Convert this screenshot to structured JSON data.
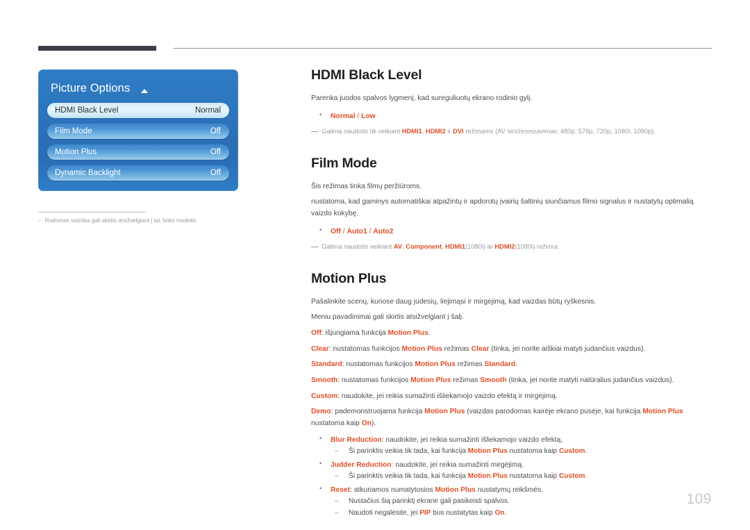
{
  "page": {
    "number": "109"
  },
  "osd": {
    "title": "Picture Options",
    "rows": [
      {
        "label": "HDMI Black Level",
        "value": "Normal",
        "selected": true
      },
      {
        "label": "Film Mode",
        "value": "Off",
        "selected": false
      },
      {
        "label": "Motion Plus",
        "value": "Off",
        "selected": false
      },
      {
        "label": "Dynamic Backlight",
        "value": "Off",
        "selected": false
      }
    ],
    "footnote": "Rodomas vaizdas gali skirtis atsižvelgiant į tai, koks modelis.",
    "footnote_dash": "–"
  },
  "colors": {
    "accent": "#e04f26",
    "osd_blue": "#2c72ba",
    "rule_dark": "#423d4b"
  },
  "sections": {
    "hdmi_black_level": {
      "heading": "HDMI Black Level",
      "intro": "Parenka juodos spalvos lygmenį, kad sureguliuotų ekrano rodinio gylį.",
      "options": "Normal / Low",
      "option_a": "Normal",
      "option_sep": " / ",
      "option_b": "Low",
      "note_pre": "Galima naudotis tik veikiant ",
      "note_t1": "HDMI1",
      "note_mid1": ", ",
      "note_t2": "HDMI2",
      "note_mid2": " ir ",
      "note_t3": "DVI",
      "note_post": " režimams (AV sinchronizavimas: 480p, 576p, 720p, 1080i, 1080p)."
    },
    "film_mode": {
      "heading": "Film Mode",
      "line1": "Šis režimas tinka filmų peržiūroms.",
      "line2": "nustatoma, kad gaminys automatiškai atpažintų ir apdorotų įvairių šaltinių siunčiamus filmo signalus ir nustatytų optimalią vaizdo kokybę.",
      "opt_a": "Off",
      "opt_sep1": " / ",
      "opt_b": "Auto1",
      "opt_sep2": " / ",
      "opt_c": "Auto2",
      "note_pre": "Galima naudotis veikiant ",
      "note_t1": "AV",
      "note_mid1": ", ",
      "note_t2": "Component",
      "note_mid2": ", ",
      "note_t3": "HDMI1",
      "note_mid3": "(1080i) ar ",
      "note_t4": "HDMI2",
      "note_post": "(1080i) režimui."
    },
    "motion_plus": {
      "heading": "Motion Plus",
      "intro1": "Pašalinkite scenų, kuriose daug judesių, liejimąsi ir mirgėjimą, kad vaizdas būtų ryškesnis.",
      "intro2": "Meniu pavadinimai gali skirtis atsižvelgiant į šalį.",
      "off_term": "Off",
      "off_text1": ": išjungiama funkcija ",
      "off_term2": "Motion Plus",
      "off_text2": ".",
      "clear_term": "Clear",
      "clear_text1": ": nustatomas funkcijos ",
      "clear_term2": "Motion Plus",
      "clear_text2": " režimas ",
      "clear_term3": "Clear",
      "clear_text3": " (tinka, jei norite aiškiai matyti judančius vaizdus).",
      "standard_term": "Standard",
      "standard_text1": ": nustatomas funkcijos ",
      "standard_term2": "Motion Plus",
      "standard_text2": " režimas ",
      "standard_term3": "Standard",
      "standard_text3": ".",
      "smooth_term": "Smooth",
      "smooth_text1": ": nustatomas funkcijos ",
      "smooth_term2": "Motion Plus",
      "smooth_text2": "  režimas ",
      "smooth_term3": "Smooth",
      "smooth_text3": " (tinka, jei norite matyti natūralius judančius vaizdus).",
      "custom_term": "Custom",
      "custom_text": ": naudokite, jei reikia sumažinti išliekamojo vaizdo efektą ir mirgėjimą.",
      "demo_term": "Demo",
      "demo_text1": ": pademonstruojama funkcija ",
      "demo_term2": "Motion Plus",
      "demo_text2": " (vaizdas parodomas kairėje ekrano pusėje, kai funkcija ",
      "demo_term3": "Motion Plus",
      "demo_text3": " nustatoma kaip ",
      "demo_term4": "On",
      "demo_text4": ").",
      "blur_term": "Blur Reduction",
      "blur_text": ": naudokite, jei reikia sumažinti išliekamojo vaizdo efektą.",
      "blur_sub_pre": "Ši parinktis veikia tik tada, kai funkcija ",
      "blur_sub_t1": "Motion Plus",
      "blur_sub_mid": " nustatoma kaip ",
      "blur_sub_t2": "Custom",
      "blur_sub_post": ".",
      "judder_term": "Judder Reduction",
      "judder_text": ": naudokite, jei reikia sumažinti mirgėjimą.",
      "judder_sub_pre": "Ši parinktis veikia tik tada, kai funkcija ",
      "judder_sub_t1": "Motion Plus",
      "judder_sub_mid": " nustatoma kaip ",
      "judder_sub_t2": "Custom",
      "judder_sub_post": ".",
      "reset_term": "Reset",
      "reset_text1": ": atkuriamos numatytosios ",
      "reset_term2": "Motion Plus",
      "reset_text2": " nustatymų reikšmės.",
      "reset_sub1": "Nustačius šią parinktį ekrane gali pasikeisti spalvos.",
      "reset_sub2_pre": "Naudoti negalėsite, jei ",
      "reset_sub2_t1": "PIP",
      "reset_sub2_mid": " bus nustatytas kaip ",
      "reset_sub2_t2": "On",
      "reset_sub2_post": "."
    }
  }
}
